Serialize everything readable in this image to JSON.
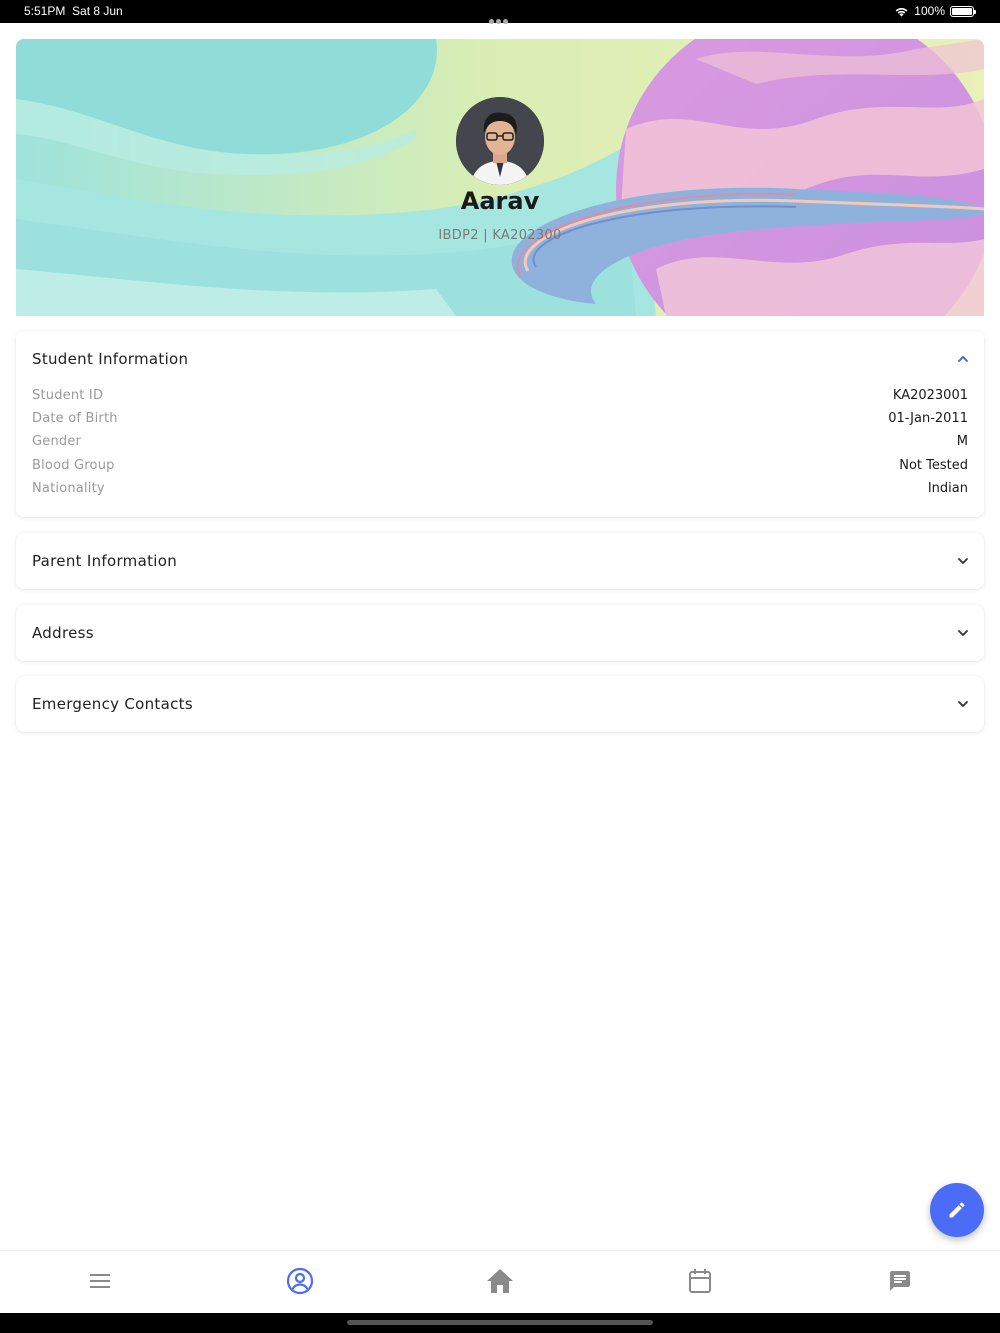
{
  "status_bar": {
    "time": "5:51PM",
    "date": "Sat 8 Jun",
    "battery": "100%"
  },
  "profile": {
    "name": "Aarav",
    "subtitle": "IBDP2 | KA202300"
  },
  "student_info": {
    "title": "Student Information",
    "expanded": true,
    "rows": [
      {
        "label": "Student ID",
        "value": "KA2023001"
      },
      {
        "label": "Date of Birth",
        "value": "01-Jan-2011"
      },
      {
        "label": "Gender",
        "value": "M"
      },
      {
        "label": "Blood Group",
        "value": "Not Tested"
      },
      {
        "label": "Nationality",
        "value": "Indian"
      }
    ]
  },
  "sections": {
    "parent": "Parent Information",
    "address": "Address",
    "emergency": "Emergency Contacts"
  },
  "bottom_nav": {
    "items": [
      "menu-icon",
      "profile-icon",
      "home-icon",
      "calendar-icon",
      "chat-icon"
    ],
    "active": "profile-icon"
  },
  "colors": {
    "accent": "#4a6cf7",
    "nav_inactive": "#8a8a8a"
  }
}
